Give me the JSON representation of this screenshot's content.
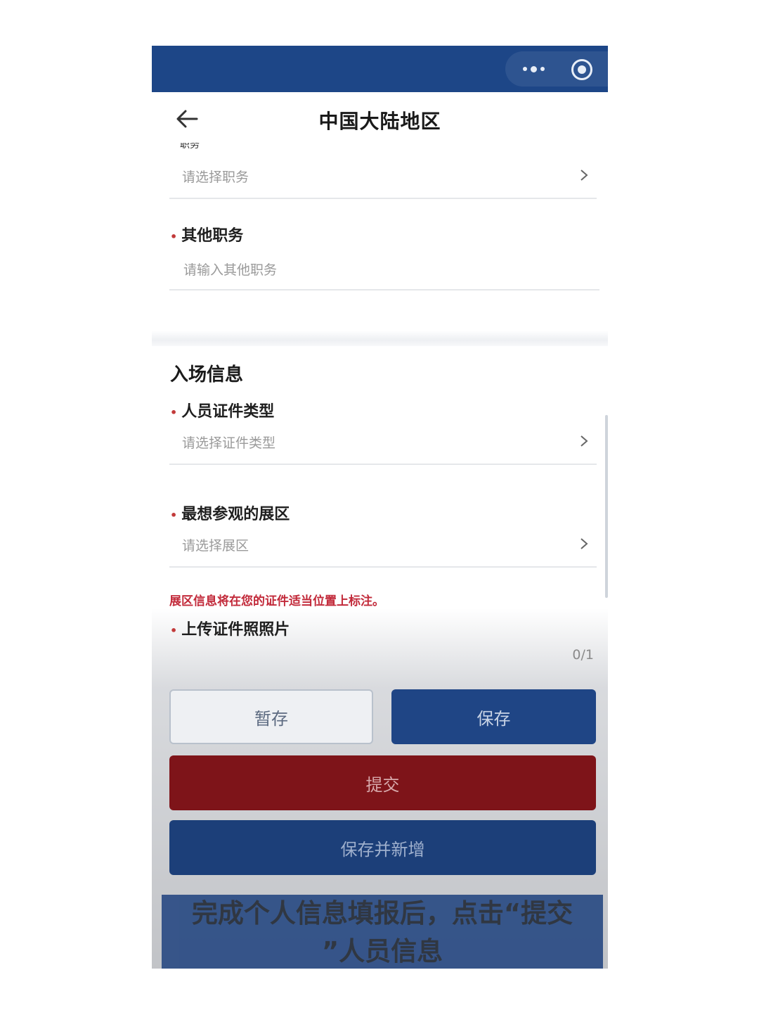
{
  "navbar": {
    "title": "中国大陆地区"
  },
  "form": {
    "cut_label": "职务",
    "position_select": {
      "placeholder": "请选择职务"
    },
    "other_position": {
      "label": "其他职务",
      "placeholder": "请输入其他职务"
    },
    "section_title": "入场信息",
    "id_type": {
      "label": "人员证件类型",
      "placeholder": "请选择证件类型"
    },
    "exhibit_area": {
      "label": "最想参观的展区",
      "placeholder": "请选择展区"
    },
    "note": "展区信息将在您的证件适当位置上标注。",
    "upload": {
      "label": "上传证件照照片",
      "count": "0/1"
    }
  },
  "buttons": {
    "temp_save": "暂存",
    "save": "保存",
    "submit": "提交",
    "save_new": "保存并新增"
  },
  "caption": {
    "line1": "完成个人信息填报后，点击“提交",
    "line2": "”人员信息"
  },
  "icons": {
    "more": "more-dots-icon",
    "target": "target-icon",
    "back": "back-arrow-icon",
    "chevron": "chevron-right-icon"
  },
  "colors": {
    "brand_blue": "#1d4687",
    "submit_red": "#7e1419",
    "note_red": "#c22a3a"
  }
}
